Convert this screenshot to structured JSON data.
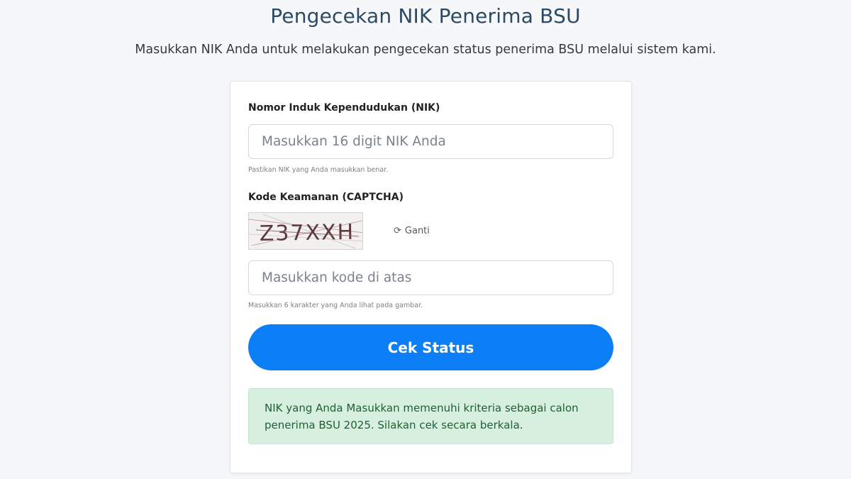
{
  "header": {
    "title": "Pengecekan NIK Penerima BSU",
    "subtitle": "Masukkan NIK Anda untuk melakukan pengecekan status penerima BSU melalui sistem kami."
  },
  "form": {
    "nik": {
      "label": "Nomor Induk Kependudukan (NIK)",
      "placeholder": "Masukkan 16 digit NIK Anda",
      "value": "",
      "help": "Pastikan NIK yang Anda masukkan benar."
    },
    "captcha": {
      "label": "Kode Keamanan (CAPTCHA)",
      "code": "Z37XXH",
      "refresh_icon": "refresh-icon",
      "refresh_label": "Ganti",
      "placeholder": "Masukkan kode di atas",
      "value": "",
      "help": "Masukkan 6 karakter yang Anda lihat pada gambar."
    },
    "submit_label": "Cek Status"
  },
  "result": {
    "message": "NIK yang Anda Masukkan memenuhi kriteria sebagai calon penerima BSU 2025. Silakan cek secara berkala."
  },
  "colors": {
    "background": "#f5f7f8",
    "title": "#2c4a66",
    "primary": "#0d7ff6",
    "success_bg": "#d7efdf",
    "success_text": "#1f5f33"
  }
}
